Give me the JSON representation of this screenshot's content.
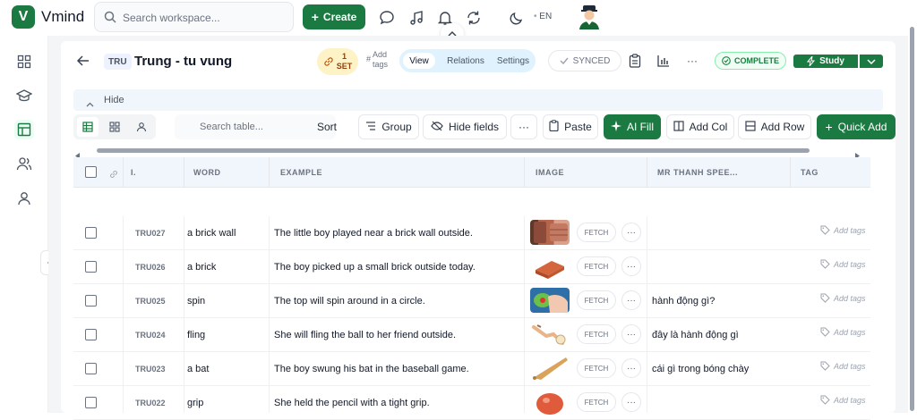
{
  "topbar": {
    "logo_letter": "V",
    "app_name": "Vmind",
    "search_placeholder": "Search workspace...",
    "create_label": "Create",
    "language": "EN"
  },
  "header": {
    "code": "TRU",
    "title": "Trung - tu vung",
    "set_count": "1",
    "set_label": "SET",
    "add_tags_line1": "Add",
    "add_tags_line2": "tags",
    "tabs": [
      {
        "label": "View",
        "active": true
      },
      {
        "label": "Relations",
        "active": false
      },
      {
        "label": "Settings",
        "active": false
      }
    ],
    "synced_label": "SYNCED",
    "complete_label": "COMPLETE",
    "study_label": "Study"
  },
  "hide_bar": {
    "label": "Hide"
  },
  "toolbar": {
    "search_placeholder": "Search table...",
    "sort": "Sort",
    "group": "Group",
    "hide_fields": "Hide fields",
    "more": "···",
    "paste": "Paste",
    "ai_fill": "AI Fill",
    "add_col": "Add Col",
    "add_row": "Add Row",
    "quick_add": "Quick Add"
  },
  "table": {
    "columns": [
      "I.",
      "WORD",
      "EXAMPLE",
      "IMAGE",
      "MR THANH SPEE...",
      "TAG"
    ],
    "fetch_label": "FETCH",
    "add_tags_label": "Add tags",
    "rows": [
      {
        "id": "TRU027",
        "word": "a brick wall",
        "example": "The little boy played near a brick wall outside.",
        "note": "",
        "image": "brick-wall"
      },
      {
        "id": "TRU026",
        "word": "a brick",
        "example": "The boy picked up a small brick outside today.",
        "note": "",
        "image": "brick"
      },
      {
        "id": "TRU025",
        "word": "spin",
        "example": "The top will spin around in a circle.",
        "note": "hành động gì?",
        "image": "spin"
      },
      {
        "id": "TRU024",
        "word": "fling",
        "example": "She will fling the ball to her friend outside.",
        "note": "đây là hành động gì",
        "image": "fling"
      },
      {
        "id": "TRU023",
        "word": "a bat",
        "example": "The boy swung his bat in the baseball game.",
        "note": "cái gì trong bóng chày",
        "image": "bat"
      },
      {
        "id": "TRU022",
        "word": "grip",
        "example": "She held the pencil with a tight grip.",
        "note": "",
        "image": "grip"
      }
    ]
  },
  "colors": {
    "brand": "#1b7a42",
    "header_bg": "#f0f6fb",
    "page_bg": "#f3f5f7"
  }
}
